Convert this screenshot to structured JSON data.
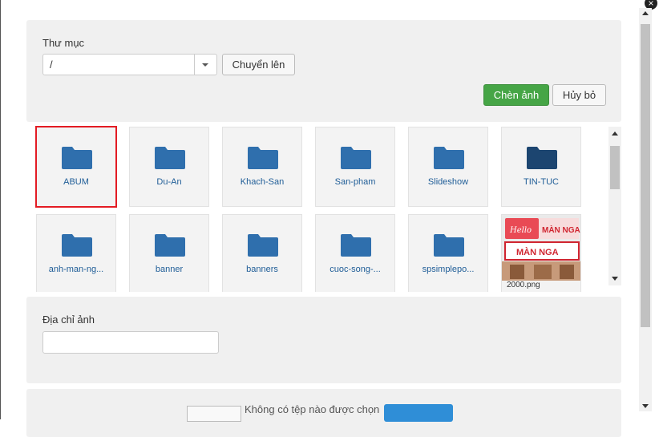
{
  "folder_panel": {
    "label": "Thư mục",
    "path_value": "/",
    "up_button": "Chuyển lên",
    "insert_button": "Chèn ảnh",
    "cancel_button": "Hủy bỏ"
  },
  "items": [
    {
      "name": "ABUM",
      "type": "folder",
      "selected": true
    },
    {
      "name": "Du-An",
      "type": "folder"
    },
    {
      "name": "Khach-San",
      "type": "folder"
    },
    {
      "name": "San-pham",
      "type": "folder"
    },
    {
      "name": "Slideshow",
      "type": "folder"
    },
    {
      "name": "TIN-TUC",
      "type": "folder",
      "dark": true
    },
    {
      "name": "anh-man-ng...",
      "type": "folder"
    },
    {
      "name": "banner",
      "type": "folder"
    },
    {
      "name": "banners",
      "type": "folder"
    },
    {
      "name": "cuoc-song-...",
      "type": "folder"
    },
    {
      "name": "spsimplepo...",
      "type": "folder"
    },
    {
      "name": "2000.png",
      "type": "image",
      "thumb_text": {
        "hello": "Hello",
        "sign": "MÀN NGA",
        "banner": "MÀN NGA"
      }
    }
  ],
  "url_panel": {
    "label": "Địa chỉ ảnh"
  },
  "upload_panel": {
    "status": "Không có tệp nào được chọn"
  },
  "colors": {
    "folder": "#2f6fad",
    "folder_dark": "#1c4570",
    "insert": "#46a546",
    "selection": "#e31b23"
  }
}
